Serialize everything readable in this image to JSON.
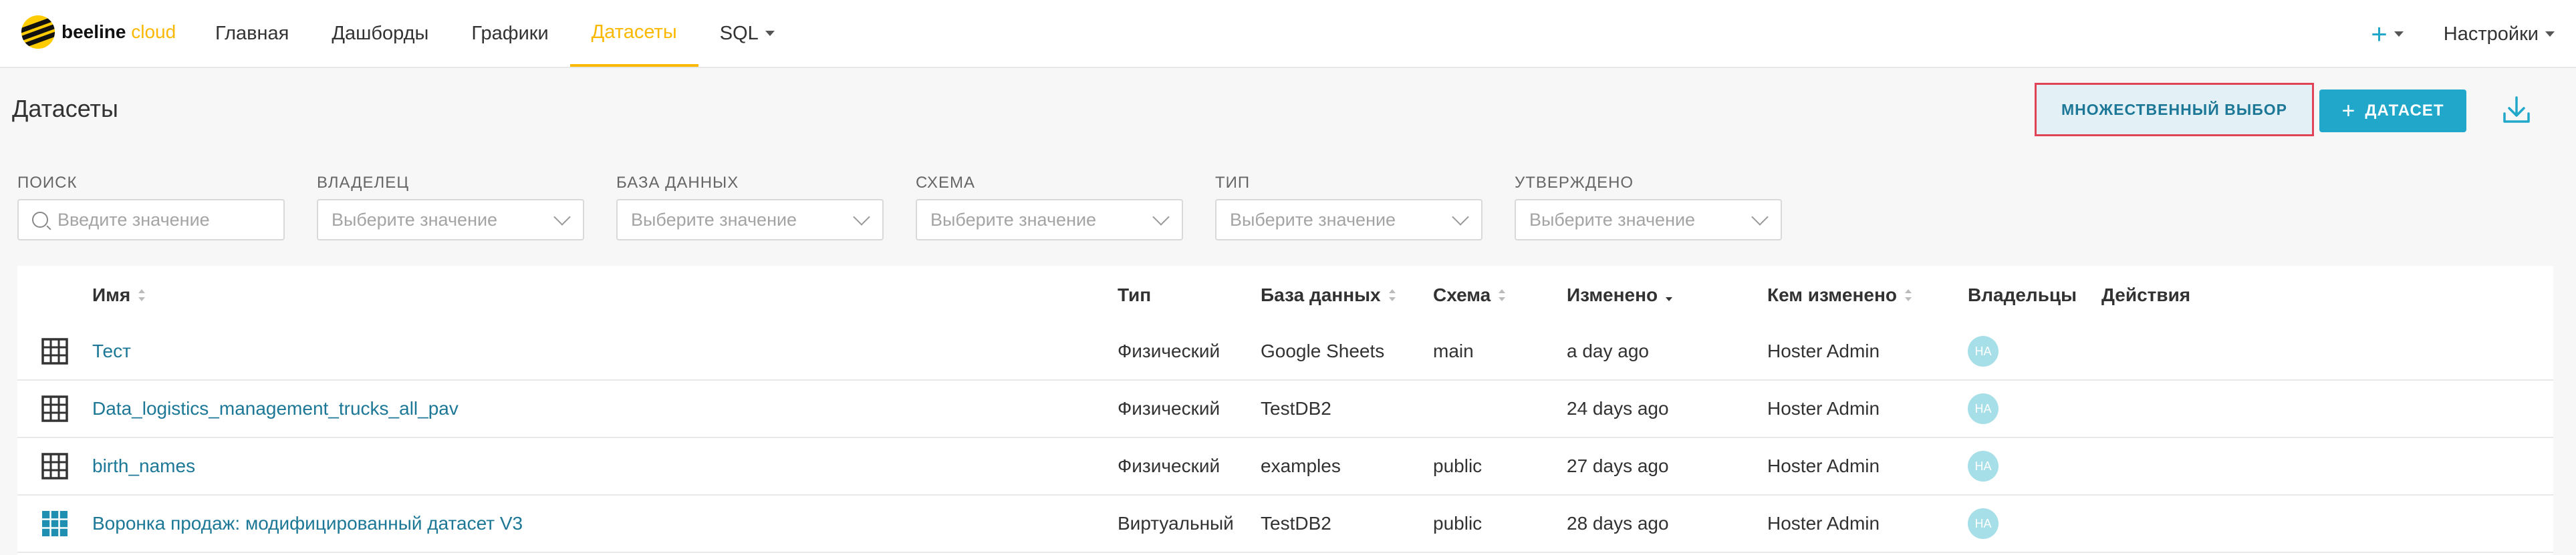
{
  "brand": {
    "name_part1": "beeline",
    "name_part2": "cloud"
  },
  "nav": {
    "items": [
      {
        "label": "Главная"
      },
      {
        "label": "Дашборды"
      },
      {
        "label": "Графики"
      },
      {
        "label": "Датасеты",
        "active": true
      },
      {
        "label": "SQL"
      }
    ],
    "plus_label": "+",
    "settings_label": "Настройки"
  },
  "header": {
    "title": "Датасеты",
    "multi_select_label": "МНОЖЕСТВЕННЫЙ ВЫБОР",
    "add_dataset_label": "ДАТАСЕТ",
    "add_dataset_plus": "+"
  },
  "filters": [
    {
      "label": "ПОИСК",
      "placeholder": "Введите значение"
    },
    {
      "label": "ВЛАДЕЛЕЦ",
      "placeholder": "Выберите значение"
    },
    {
      "label": "БАЗА ДАННЫХ",
      "placeholder": "Выберите значение"
    },
    {
      "label": "СХЕМА",
      "placeholder": "Выберите значение"
    },
    {
      "label": "ТИП",
      "placeholder": "Выберите значение"
    },
    {
      "label": "УТВЕРЖДЕНО",
      "placeholder": "Выберите значение"
    }
  ],
  "table": {
    "columns": {
      "name": "Имя",
      "type": "Тип",
      "database": "База данных",
      "schema": "Схема",
      "modified": "Изменено",
      "modified_by": "Кем изменено",
      "owners": "Владельцы",
      "actions": "Действия"
    },
    "rows": [
      {
        "icon": "table-icon",
        "name": "Тест",
        "type": "Физический",
        "database": "Google Sheets",
        "schema": "main",
        "modified": "a day ago",
        "modified_by": "Hoster Admin",
        "owner": "HA"
      },
      {
        "icon": "table-icon",
        "name": "Data_logistics_management_trucks_all_pav",
        "type": "Физический",
        "database": "TestDB2",
        "schema": "",
        "modified": "24 days ago",
        "modified_by": "Hoster Admin",
        "owner": "HA"
      },
      {
        "icon": "table-icon",
        "name": "birth_names",
        "type": "Физический",
        "database": "examples",
        "schema": "public",
        "modified": "27 days ago",
        "modified_by": "Hoster Admin",
        "owner": "HA"
      },
      {
        "icon": "virtual-table-icon",
        "name": "Воронка продаж: модифицированный датасет V3",
        "type": "Виртуальный",
        "database": "TestDB2",
        "schema": "public",
        "modified": "28 days ago",
        "modified_by": "Hoster Admin",
        "owner": "HA"
      }
    ]
  },
  "colors": {
    "accent": "#20a7c9",
    "brand_yellow": "#fbb800",
    "link": "#1c7896",
    "highlight_border": "#e04355"
  }
}
